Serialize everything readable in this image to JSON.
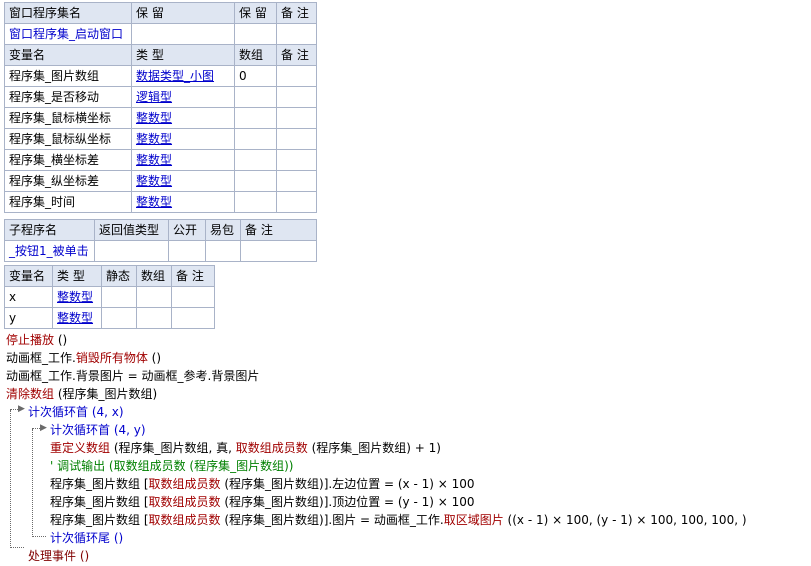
{
  "table1": {
    "header": [
      "窗口程序集名",
      "保 留",
      "保 留",
      "备 注"
    ],
    "row": [
      "窗口程序集_启动窗口",
      "",
      "",
      ""
    ]
  },
  "table2": {
    "header": [
      "变量名",
      "类 型",
      "数组",
      "备 注"
    ],
    "rows": [
      [
        "程序集_图片数组",
        "数据类型_小图",
        "0",
        ""
      ],
      [
        "程序集_是否移动",
        "逻辑型",
        "",
        ""
      ],
      [
        "程序集_鼠标横坐标",
        "整数型",
        "",
        ""
      ],
      [
        "程序集_鼠标纵坐标",
        "整数型",
        "",
        ""
      ],
      [
        "程序集_横坐标差",
        "整数型",
        "",
        ""
      ],
      [
        "程序集_纵坐标差",
        "整数型",
        "",
        ""
      ],
      [
        "程序集_时间",
        "整数型",
        "",
        ""
      ]
    ]
  },
  "table3": {
    "header": [
      "子程序名",
      "返回值类型",
      "公开",
      "易包",
      "备 注"
    ],
    "row": [
      "_按钮1_被单击",
      "",
      "",
      "",
      ""
    ]
  },
  "table4": {
    "header": [
      "变量名",
      "类 型",
      "静态",
      "数组",
      "备 注"
    ],
    "rows": [
      [
        "x",
        "整数型",
        "",
        "",
        ""
      ],
      [
        "y",
        "整数型",
        "",
        "",
        ""
      ]
    ]
  },
  "code": {
    "l1_cmd": "停止播放",
    "l1_args": " ()",
    "l2_obj": "动画框_工作.",
    "l2_cmd": "销毁所有物体",
    "l2_args": " ()",
    "l3": "动画框_工作.背景图片 = 动画框_参考.背景图片",
    "l4_cmd": "清除数组",
    "l4_args": " (程序集_图片数组)",
    "l5": "计次循环首 (4, x)",
    "l6": "计次循环首 (4, y)",
    "l7_cmd": "重定义数组",
    "l7_a": " (程序集_图片数组, 真, ",
    "l7_fn": "取数组成员数",
    "l7_b": " (程序集_图片数组) + 1)",
    "l8": "' 调试输出 (取数组成员数 (程序集_图片数组))",
    "l9_a": "程序集_图片数组 [",
    "l9_fn": "取数组成员数",
    "l9_b": " (程序集_图片数组)].左边位置 = (x - 1) × 100",
    "l10_a": "程序集_图片数组 [",
    "l10_fn": "取数组成员数",
    "l10_b": " (程序集_图片数组)].顶边位置 = (y - 1) × 100",
    "l11_a": "程序集_图片数组 [",
    "l11_fn": "取数组成员数",
    "l11_b": " (程序集_图片数组)].图片 = 动画框_工作.",
    "l11_fn2": "取区域图片",
    "l11_c": " ((x - 1) × 100, (y - 1) × 100, 100, 100, )",
    "l12": "计次循环尾 ()",
    "l13": "处理事件 ()"
  }
}
